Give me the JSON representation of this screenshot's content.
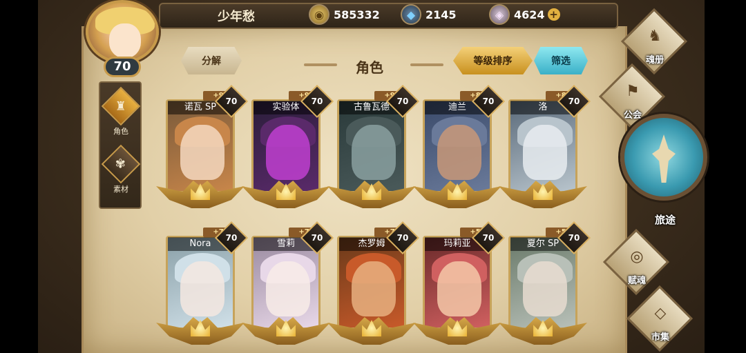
{
  "player": {
    "name": "少年愁",
    "level": "70"
  },
  "resources": {
    "gold": {
      "icon": "gold-coin-icon",
      "value": "585332"
    },
    "gem": {
      "icon": "blue-crystal-icon",
      "value": "2145"
    },
    "crystal": {
      "icon": "pink-gem-icon",
      "value": "4624",
      "plus": "+"
    }
  },
  "side_tabs": [
    {
      "label": "角色",
      "icon": "helmet-icon",
      "active": true
    },
    {
      "label": "素材",
      "icon": "material-icon",
      "active": false
    }
  ],
  "header": {
    "title": "角色",
    "decompose": "分解",
    "sort": "等级排序",
    "filter": "筛选"
  },
  "characters": [
    {
      "name": "诺瓦 SP",
      "level": "70",
      "plus": "+9"
    },
    {
      "name": "实验体",
      "level": "70",
      "plus": "+9"
    },
    {
      "name": "古鲁瓦德",
      "level": "70",
      "plus": "+9"
    },
    {
      "name": "迪兰",
      "level": "70",
      "plus": "+8"
    },
    {
      "name": "洛",
      "level": "70",
      "plus": "+8"
    },
    {
      "name": "Nora",
      "level": "70",
      "plus": "+7"
    },
    {
      "name": "雪莉",
      "level": "70",
      "plus": "+7"
    },
    {
      "name": "杰罗姆",
      "level": "70",
      "plus": "+7"
    },
    {
      "name": "玛莉亚",
      "level": "70",
      "plus": "+5"
    },
    {
      "name": "夏尔 SP",
      "level": "70",
      "plus": "+5"
    }
  ],
  "right_menu": [
    {
      "label": "魂册",
      "icon": "soul-book-icon"
    },
    {
      "label": "公会",
      "icon": "guild-icon"
    },
    {
      "label": "旅途",
      "icon": "journey-icon"
    },
    {
      "label": "赋魂",
      "icon": "soul-infuse-icon"
    },
    {
      "label": "市集",
      "icon": "market-icon"
    }
  ]
}
